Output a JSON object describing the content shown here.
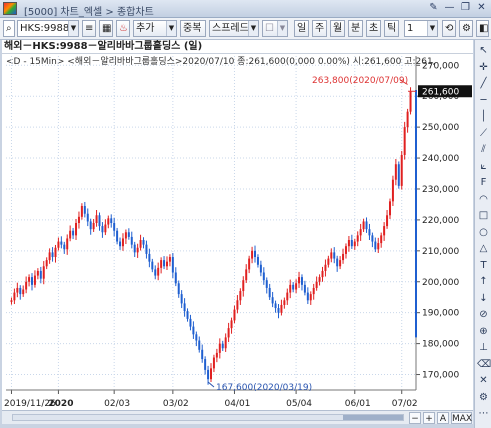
{
  "window": {
    "title": "[5000] 차트_엑셀 > 종합차트",
    "buttons": [
      "pin-icon",
      "minimize-icon",
      "restore-icon",
      "close-icon"
    ]
  },
  "toolbar": {
    "symbol": "HKS:9988",
    "add_label": "추가",
    "overlay_label": "중복",
    "spread_label": "스프레드",
    "period_buttons": [
      "일",
      "주",
      "월",
      "분",
      "초",
      "틱"
    ],
    "count_value": "1"
  },
  "chart": {
    "title": "해외－HKS:9988－알리바바그룹홀딩스 (일)",
    "info_line": "<D - 15Min>  <해외－알리바바그룹홀딩스>2020/07/10 종:261,600(0,000 0.00%) 시:261,600 고:261,",
    "current_price": "261,600",
    "high_annotation": "263,800(2020/07/09)",
    "low_annotation": "167,600(2020/03/19)",
    "y_labels": [
      "270,000",
      "260,000",
      "250,000",
      "240,000",
      "230,000",
      "220,000",
      "210,000",
      "200,000",
      "190,000",
      "180,000",
      "170,000"
    ],
    "x_labels": [
      "2019/11/26",
      "2020",
      "02/03",
      "03/02",
      "04/01",
      "05/04",
      "06/01",
      "07/02"
    ],
    "colors": {
      "up": "#e02020",
      "down": "#1f5fd0",
      "grid": "#c9d7ea",
      "highlight_axis": "#1f5fd0"
    }
  },
  "chart_data": {
    "type": "candlestick",
    "ylim": [
      165000,
      273000
    ],
    "current": 261600,
    "high": {
      "value": 263800,
      "date": "2020/07/09"
    },
    "low": {
      "value": 167600,
      "date": "2020/03/19"
    },
    "close": [
      194000,
      196500,
      198000,
      196000,
      197500,
      200000,
      201500,
      199000,
      202000,
      203500,
      201000,
      205000,
      207000,
      209500,
      208000,
      211000,
      213000,
      212000,
      210500,
      214000,
      216500,
      215000,
      219000,
      221000,
      224500,
      222000,
      219500,
      217000,
      219000,
      221500,
      218000,
      216000,
      218500,
      220500,
      219000,
      216500,
      213000,
      211500,
      214000,
      216000,
      214500,
      212000,
      209500,
      211000,
      213500,
      212000,
      209000,
      206500,
      204000,
      202000,
      204500,
      207000,
      205000,
      206500,
      208000,
      203000,
      199500,
      196000,
      193000,
      190500,
      188000,
      185500,
      183000,
      181000,
      178000,
      175000,
      171500,
      168500,
      172000,
      175500,
      177000,
      180000,
      178500,
      182000,
      185000,
      187500,
      191000,
      194000,
      197000,
      200500,
      204000,
      207500,
      210000,
      208000,
      205500,
      203000,
      200500,
      198000,
      195000,
      193000,
      191500,
      190000,
      192500,
      194000,
      196500,
      199000,
      197500,
      199500,
      201500,
      199000,
      196500,
      194000,
      196000,
      198000,
      200000,
      201500,
      203500,
      205500,
      207500,
      209500,
      207500,
      205000,
      207000,
      209000,
      211500,
      213500,
      211500,
      213000,
      215000,
      217000,
      219500,
      217000,
      215000,
      213000,
      210500,
      212500,
      215000,
      218000,
      221500,
      226000,
      233000,
      238000,
      231000,
      241000,
      250000,
      255000,
      261600
    ],
    "x_ticks": [
      "2019/11/26",
      "2020",
      "02/03",
      "03/02",
      "04/01",
      "05/04",
      "06/01",
      "07/02"
    ]
  },
  "side": {
    "items": [
      "pointer-icon",
      "crosshair-icon",
      "line-icon",
      "horizontal-line-icon",
      "vertical-line-icon",
      "trend-line-icon",
      "channel-icon",
      "fan-icon",
      "fibonacci-icon",
      "arc-icon",
      "rectangle-icon",
      "ellipse-icon",
      "triangle-icon",
      "text-icon",
      "arrow-up-icon",
      "arrow-down-icon",
      "hide-icon",
      "magnet-icon",
      "ruler-icon",
      "eraser-icon",
      "delete-icon",
      "settings-icon",
      "more-icon"
    ],
    "glyphs": [
      "↖",
      "✛",
      "╱",
      "─",
      "│",
      "⟋",
      "⫽",
      "⟀",
      "F",
      "◠",
      "□",
      "○",
      "△",
      "T",
      "↑",
      "↓",
      "⊘",
      "⊕",
      "⊥",
      "⌫",
      "✕",
      "⚙",
      "⋯"
    ]
  },
  "bottom": {
    "minus": "−",
    "plus": "+",
    "all": "A",
    "max": "MAX"
  }
}
